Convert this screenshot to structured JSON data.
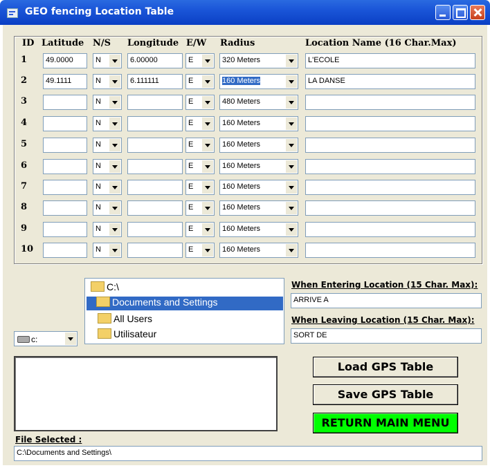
{
  "window": {
    "title": "GEO fencing  Location Table"
  },
  "headers": {
    "id": "ID",
    "latitude": "Latitude",
    "ns": "N/S",
    "longitude": "Longitude",
    "ew": "E/W",
    "radius": "Radius",
    "name": "Location Name (16 Char.Max)"
  },
  "rows": [
    {
      "id": "1",
      "lat": "49.0000",
      "ns": "N",
      "lon": "6.00000",
      "ew": "E",
      "radius": "320 Meters",
      "name": "L'ECOLE"
    },
    {
      "id": "2",
      "lat": "49.1111",
      "ns": "N",
      "lon": "6.111111",
      "ew": "E",
      "radius": "160 Meters",
      "name": "LA DANSE"
    },
    {
      "id": "3",
      "lat": "",
      "ns": "N",
      "lon": "",
      "ew": "E",
      "radius": "480 Meters",
      "name": ""
    },
    {
      "id": "4",
      "lat": "",
      "ns": "N",
      "lon": "",
      "ew": "E",
      "radius": "160 Meters",
      "name": ""
    },
    {
      "id": "5",
      "lat": "",
      "ns": "N",
      "lon": "",
      "ew": "E",
      "radius": "160 Meters",
      "name": ""
    },
    {
      "id": "6",
      "lat": "",
      "ns": "N",
      "lon": "",
      "ew": "E",
      "radius": "160 Meters",
      "name": ""
    },
    {
      "id": "7",
      "lat": "",
      "ns": "N",
      "lon": "",
      "ew": "E",
      "radius": "160 Meters",
      "name": ""
    },
    {
      "id": "8",
      "lat": "",
      "ns": "N",
      "lon": "",
      "ew": "E",
      "radius": "160 Meters",
      "name": ""
    },
    {
      "id": "9",
      "lat": "",
      "ns": "N",
      "lon": "",
      "ew": "E",
      "radius": "160 Meters",
      "name": ""
    },
    {
      "id": "10",
      "lat": "",
      "ns": "N",
      "lon": "",
      "ew": "E",
      "radius": "160 Meters",
      "name": ""
    }
  ],
  "directory": [
    "C:\\",
    "Documents and Settings",
    "All Users",
    "Utilisateur"
  ],
  "drive": "c:",
  "entering": {
    "label": "When Entering Location (15 Char. Max):",
    "value": "ARRIVE A"
  },
  "leaving": {
    "label": "When Leaving Location (15 Char. Max):",
    "value": "SORT DE"
  },
  "buttons": {
    "load": "Load GPS Table",
    "save": "Save GPS Table",
    "return": "RETURN MAIN MENU"
  },
  "file": {
    "label": "File Selected :",
    "value": "C:\\Documents and Settings\\"
  },
  "colors": {
    "title_bar": "#0a3fc4",
    "return_button": "#00ff00",
    "selection": "#316ac5"
  },
  "icons": [
    "window-app-icon",
    "minimize-icon",
    "maximize-icon",
    "close-icon",
    "folder-icon",
    "drive-icon",
    "chevron-down-icon"
  ]
}
